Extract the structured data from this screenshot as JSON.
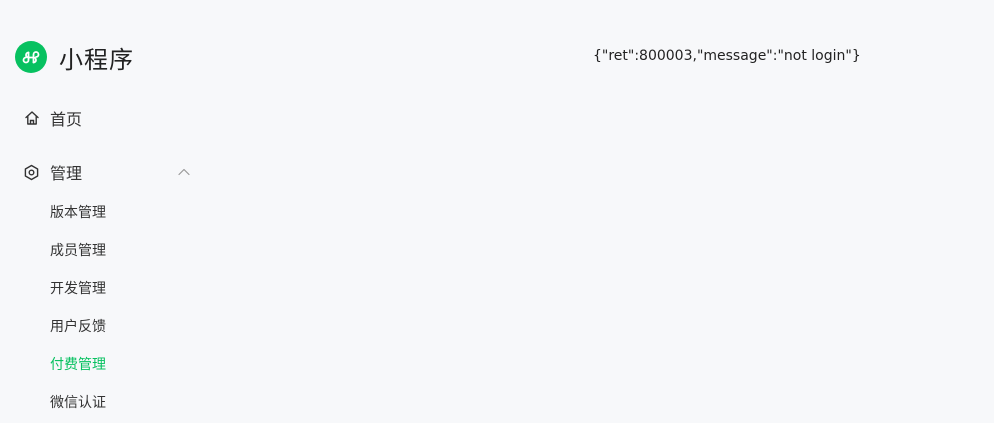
{
  "app": {
    "title": "小程序",
    "brand_color": "#07c160"
  },
  "nav": {
    "home": {
      "label": "首页",
      "icon": "home-icon"
    },
    "manage": {
      "label": "管理",
      "icon": "hexagon-gear-icon",
      "expanded": true
    },
    "sub_items": [
      {
        "label": "版本管理",
        "active": false
      },
      {
        "label": "成员管理",
        "active": false
      },
      {
        "label": "开发管理",
        "active": false
      },
      {
        "label": "用户反馈",
        "active": false
      },
      {
        "label": "付费管理",
        "active": true
      },
      {
        "label": "微信认证",
        "active": false
      }
    ]
  },
  "main": {
    "response_text": "{\"ret\":800003,\"message\":\"not login\"}"
  }
}
